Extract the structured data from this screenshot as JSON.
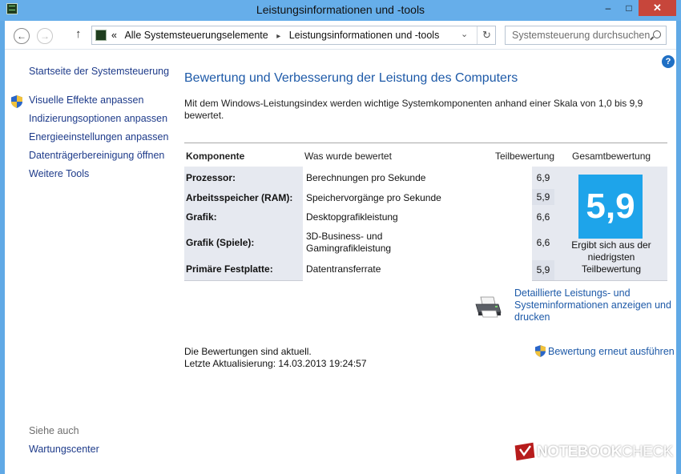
{
  "window": {
    "title": "Leistungsinformationen und -tools",
    "minimize": "–",
    "maximize": "□",
    "close": "✕"
  },
  "toolbar": {
    "back": "←",
    "forward": "→",
    "up": "↑",
    "address": {
      "prefix": "«",
      "crumbs": [
        "Alle Systemsteuerungselemente",
        "Leistungsinformationen und -tools"
      ],
      "separator": "▸",
      "dropdown": "⌄",
      "refresh": "↻"
    },
    "search_placeholder": "Systemsteuerung durchsuchen"
  },
  "sidebar": {
    "home": "Startseite der Systemsteuerung",
    "items": [
      "Visuelle Effekte anpassen",
      "Indizierungsoptionen anpassen",
      "Energieeinstellungen anpassen",
      "Datenträgerbereinigung öffnen",
      "Weitere Tools"
    ],
    "see_also": "Siehe auch",
    "see_also_link": "Wartungscenter"
  },
  "main": {
    "help": "?",
    "heading": "Bewertung und Verbesserung der Leistung des Computers",
    "intro": "Mit dem Windows-Leistungsindex werden wichtige Systemkomponenten anhand einer Skala von 1,0 bis 9,9 bewertet.",
    "table": {
      "headers": {
        "component": "Komponente",
        "what": "Was wurde bewertet",
        "subscore": "Teilbewertung",
        "total": "Gesamtbewertung"
      },
      "rows": [
        {
          "component": "Prozessor:",
          "what": "Berechnungen pro Sekunde",
          "score": "6,9"
        },
        {
          "component": "Arbeitsspeicher (RAM):",
          "what": "Speichervorgänge pro Sekunde",
          "score": "5,9"
        },
        {
          "component": "Grafik:",
          "what": "Desktopgrafikleistung",
          "score": "6,6"
        },
        {
          "component": "Grafik (Spiele):",
          "what": "3D-Business- und Gamingrafikleistung",
          "score": "6,6"
        },
        {
          "component": "Primäre Festplatte:",
          "what": "Datentransferrate",
          "score": "5,9"
        }
      ],
      "total_score": "5,9",
      "total_note": "Ergibt sich aus der niedrigsten Teilbewertung"
    },
    "detail_link": "Detaillierte Leistungs- und Systeminformationen anzeigen und drucken",
    "status_line1": "Die Bewertungen sind aktuell.",
    "status_line2": "Letzte Aktualisierung: 14.03.2013 19:24:57",
    "rerun": "Bewertung erneut ausführen"
  },
  "watermark": {
    "text_bold": "NOTEBOOK",
    "text_light": "CHECK"
  },
  "colors": {
    "frame": "#66aeea",
    "link": "#1e5aa8",
    "score_tile": "#1ea4ea",
    "close": "#c7463b"
  }
}
